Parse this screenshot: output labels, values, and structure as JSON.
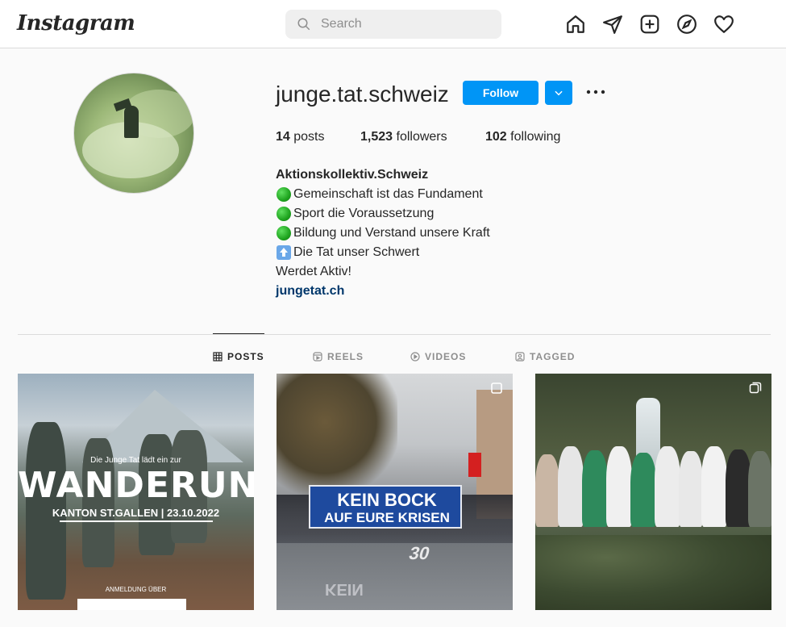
{
  "app": {
    "logo_text": "Instagram"
  },
  "search": {
    "placeholder": "Search"
  },
  "nav_icons": [
    "home-icon",
    "direct-icon",
    "new-post-icon",
    "explore-icon",
    "activity-icon"
  ],
  "profile": {
    "username": "junge.tat.schweiz",
    "follow_label": "Follow",
    "stats": {
      "posts_count": "14",
      "posts_label": "posts",
      "followers_count": "1,523",
      "followers_label": "followers",
      "following_count": "102",
      "following_label": "following"
    },
    "bio": {
      "name": "Aktionskollektiv.Schweiz",
      "lines": [
        "Gemeinschaft ist das Fundament",
        "Sport die Voraussetzung",
        "Bildung und Verstand unsere Kraft",
        "Die Tat unser Schwert",
        "Werdet Aktiv!"
      ],
      "link": "jungetat.ch"
    }
  },
  "tabs": [
    {
      "label": "POSTS",
      "icon": "grid-icon",
      "active": true
    },
    {
      "label": "REELS",
      "icon": "reels-icon",
      "active": false
    },
    {
      "label": "VIDEOS",
      "icon": "video-icon",
      "active": false
    },
    {
      "label": "TAGGED",
      "icon": "tagged-icon",
      "active": false
    }
  ],
  "posts": [
    {
      "small_text": "Die Junge Tat lädt ein zur",
      "title": "WANDERUNG",
      "subtitle": "KANTON ST.GALLEN | 23.10.2022",
      "footer": "ANMELDUNG ÜBER"
    },
    {
      "banner_line1": "KEIN BOCK",
      "banner_line2": "AUF EURE KRISEN",
      "road_number": "30",
      "reflection": "KEIN"
    },
    {}
  ],
  "colors": {
    "accent": "#0095f6",
    "link": "#00376b",
    "border": "#dbdbdb"
  }
}
